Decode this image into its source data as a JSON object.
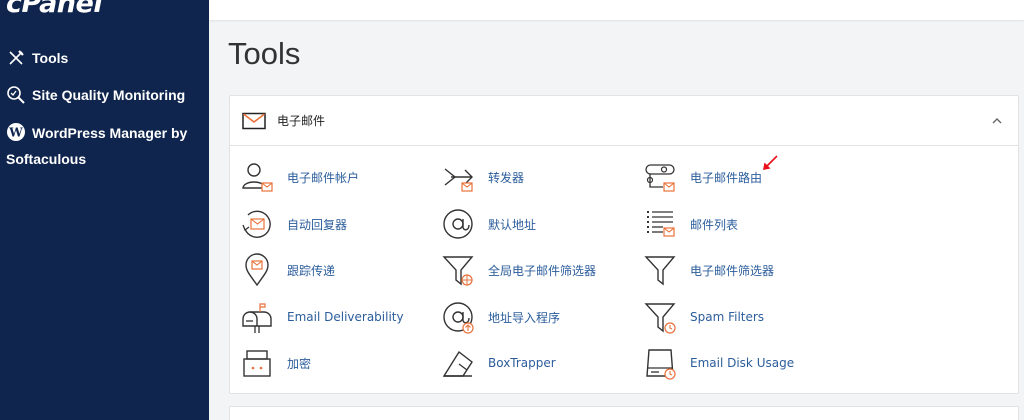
{
  "app": {
    "logo": "cPanel"
  },
  "sidebar": {
    "items": [
      {
        "label": "Tools",
        "icon": "tools-icon"
      },
      {
        "label": "Site Quality Monitoring",
        "icon": "search-icon"
      },
      {
        "label": "WordPress Manager by Softaculous",
        "icon": "wordpress-icon"
      }
    ]
  },
  "page": {
    "title": "Tools"
  },
  "email_section": {
    "title": "电子邮件",
    "collapse_icon": "chevron-up-icon",
    "items": [
      {
        "label": "电子邮件帐户",
        "icon": "email-accounts-icon"
      },
      {
        "label": "转发器",
        "icon": "forwarders-icon"
      },
      {
        "label": "电子邮件路由",
        "icon": "email-routing-icon"
      },
      {
        "label": "自动回复器",
        "icon": "autoresponders-icon"
      },
      {
        "label": "默认地址",
        "icon": "default-address-icon"
      },
      {
        "label": "邮件列表",
        "icon": "mailing-lists-icon"
      },
      {
        "label": "跟踪传递",
        "icon": "track-delivery-icon"
      },
      {
        "label": "全局电子邮件筛选器",
        "icon": "global-filters-icon"
      },
      {
        "label": "电子邮件筛选器",
        "icon": "email-filters-icon"
      },
      {
        "label": "Email Deliverability",
        "icon": "mailbox-icon"
      },
      {
        "label": "地址导入程序",
        "icon": "address-importer-icon"
      },
      {
        "label": "Spam Filters",
        "icon": "spam-filters-icon"
      },
      {
        "label": "加密",
        "icon": "encryption-icon"
      },
      {
        "label": "BoxTrapper",
        "icon": "boxtrapper-icon"
      },
      {
        "label": "Email Disk Usage",
        "icon": "disk-usage-icon"
      }
    ]
  },
  "annotation": {
    "arrow_color": "#e8101a"
  },
  "colors": {
    "sidebar": "#10254d",
    "link": "#2b5d9c",
    "accent": "#e8723a"
  }
}
